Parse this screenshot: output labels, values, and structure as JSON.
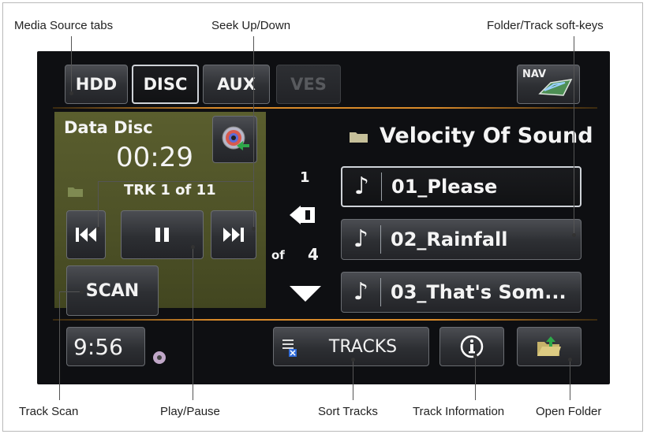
{
  "callouts": {
    "media_source_tabs": "Media Source tabs",
    "seek_up_down": "Seek Up/Down",
    "folder_track_softkeys": "Folder/Track soft-keys",
    "track_scan": "Track Scan",
    "play_pause": "Play/Pause",
    "sort_tracks": "Sort Tracks",
    "track_information": "Track Information",
    "open_folder": "Open Folder"
  },
  "tabs": [
    {
      "label": "HDD"
    },
    {
      "label": "DISC",
      "active": true
    },
    {
      "label": "AUX"
    },
    {
      "label": "VES",
      "disabled": true
    }
  ],
  "nav_label": "NAV",
  "now_playing": {
    "source": "Data Disc",
    "elapsed": "00:29",
    "track": "TRK 1 of 11"
  },
  "controls": {
    "prev_icon": "skip-back-icon",
    "pause_icon": "pause-icon",
    "next_icon": "skip-forward-icon",
    "scan_label": "SCAN"
  },
  "folder": {
    "name": "Velocity Of Sound",
    "page_current": "1",
    "page_of": "of",
    "page_total": "4"
  },
  "tracks": [
    {
      "label": "01_Please",
      "selected": true
    },
    {
      "label": "02_Rainfall"
    },
    {
      "label": "03_That's Som..."
    }
  ],
  "bottom": {
    "clock": "9:56",
    "tracks_label": "TRACKS",
    "info_icon": "info-icon",
    "open_folder_icon": "open-folder-icon"
  },
  "colors": {
    "accent_orange": "#d98a2a",
    "panel_olive": "#4d5127",
    "screen_bg": "#0e0f12"
  }
}
